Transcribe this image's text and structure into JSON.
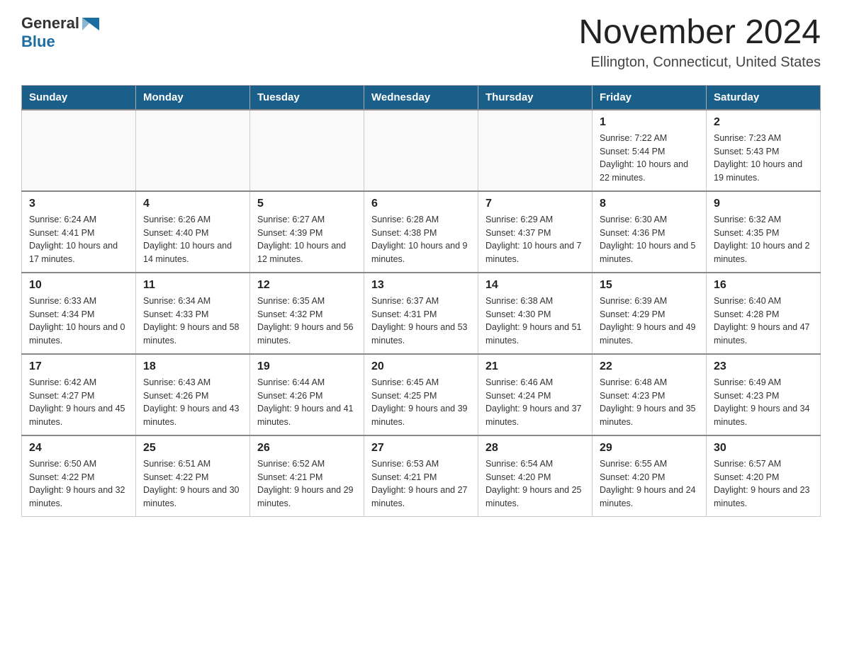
{
  "header": {
    "logo_general": "General",
    "logo_blue": "Blue",
    "title": "November 2024",
    "subtitle": "Ellington, Connecticut, United States"
  },
  "calendar": {
    "days_of_week": [
      "Sunday",
      "Monday",
      "Tuesday",
      "Wednesday",
      "Thursday",
      "Friday",
      "Saturday"
    ],
    "weeks": [
      [
        {
          "day": "",
          "info": ""
        },
        {
          "day": "",
          "info": ""
        },
        {
          "day": "",
          "info": ""
        },
        {
          "day": "",
          "info": ""
        },
        {
          "day": "",
          "info": ""
        },
        {
          "day": "1",
          "info": "Sunrise: 7:22 AM\nSunset: 5:44 PM\nDaylight: 10 hours and 22 minutes."
        },
        {
          "day": "2",
          "info": "Sunrise: 7:23 AM\nSunset: 5:43 PM\nDaylight: 10 hours and 19 minutes."
        }
      ],
      [
        {
          "day": "3",
          "info": "Sunrise: 6:24 AM\nSunset: 4:41 PM\nDaylight: 10 hours and 17 minutes."
        },
        {
          "day": "4",
          "info": "Sunrise: 6:26 AM\nSunset: 4:40 PM\nDaylight: 10 hours and 14 minutes."
        },
        {
          "day": "5",
          "info": "Sunrise: 6:27 AM\nSunset: 4:39 PM\nDaylight: 10 hours and 12 minutes."
        },
        {
          "day": "6",
          "info": "Sunrise: 6:28 AM\nSunset: 4:38 PM\nDaylight: 10 hours and 9 minutes."
        },
        {
          "day": "7",
          "info": "Sunrise: 6:29 AM\nSunset: 4:37 PM\nDaylight: 10 hours and 7 minutes."
        },
        {
          "day": "8",
          "info": "Sunrise: 6:30 AM\nSunset: 4:36 PM\nDaylight: 10 hours and 5 minutes."
        },
        {
          "day": "9",
          "info": "Sunrise: 6:32 AM\nSunset: 4:35 PM\nDaylight: 10 hours and 2 minutes."
        }
      ],
      [
        {
          "day": "10",
          "info": "Sunrise: 6:33 AM\nSunset: 4:34 PM\nDaylight: 10 hours and 0 minutes."
        },
        {
          "day": "11",
          "info": "Sunrise: 6:34 AM\nSunset: 4:33 PM\nDaylight: 9 hours and 58 minutes."
        },
        {
          "day": "12",
          "info": "Sunrise: 6:35 AM\nSunset: 4:32 PM\nDaylight: 9 hours and 56 minutes."
        },
        {
          "day": "13",
          "info": "Sunrise: 6:37 AM\nSunset: 4:31 PM\nDaylight: 9 hours and 53 minutes."
        },
        {
          "day": "14",
          "info": "Sunrise: 6:38 AM\nSunset: 4:30 PM\nDaylight: 9 hours and 51 minutes."
        },
        {
          "day": "15",
          "info": "Sunrise: 6:39 AM\nSunset: 4:29 PM\nDaylight: 9 hours and 49 minutes."
        },
        {
          "day": "16",
          "info": "Sunrise: 6:40 AM\nSunset: 4:28 PM\nDaylight: 9 hours and 47 minutes."
        }
      ],
      [
        {
          "day": "17",
          "info": "Sunrise: 6:42 AM\nSunset: 4:27 PM\nDaylight: 9 hours and 45 minutes."
        },
        {
          "day": "18",
          "info": "Sunrise: 6:43 AM\nSunset: 4:26 PM\nDaylight: 9 hours and 43 minutes."
        },
        {
          "day": "19",
          "info": "Sunrise: 6:44 AM\nSunset: 4:26 PM\nDaylight: 9 hours and 41 minutes."
        },
        {
          "day": "20",
          "info": "Sunrise: 6:45 AM\nSunset: 4:25 PM\nDaylight: 9 hours and 39 minutes."
        },
        {
          "day": "21",
          "info": "Sunrise: 6:46 AM\nSunset: 4:24 PM\nDaylight: 9 hours and 37 minutes."
        },
        {
          "day": "22",
          "info": "Sunrise: 6:48 AM\nSunset: 4:23 PM\nDaylight: 9 hours and 35 minutes."
        },
        {
          "day": "23",
          "info": "Sunrise: 6:49 AM\nSunset: 4:23 PM\nDaylight: 9 hours and 34 minutes."
        }
      ],
      [
        {
          "day": "24",
          "info": "Sunrise: 6:50 AM\nSunset: 4:22 PM\nDaylight: 9 hours and 32 minutes."
        },
        {
          "day": "25",
          "info": "Sunrise: 6:51 AM\nSunset: 4:22 PM\nDaylight: 9 hours and 30 minutes."
        },
        {
          "day": "26",
          "info": "Sunrise: 6:52 AM\nSunset: 4:21 PM\nDaylight: 9 hours and 29 minutes."
        },
        {
          "day": "27",
          "info": "Sunrise: 6:53 AM\nSunset: 4:21 PM\nDaylight: 9 hours and 27 minutes."
        },
        {
          "day": "28",
          "info": "Sunrise: 6:54 AM\nSunset: 4:20 PM\nDaylight: 9 hours and 25 minutes."
        },
        {
          "day": "29",
          "info": "Sunrise: 6:55 AM\nSunset: 4:20 PM\nDaylight: 9 hours and 24 minutes."
        },
        {
          "day": "30",
          "info": "Sunrise: 6:57 AM\nSunset: 4:20 PM\nDaylight: 9 hours and 23 minutes."
        }
      ]
    ]
  }
}
